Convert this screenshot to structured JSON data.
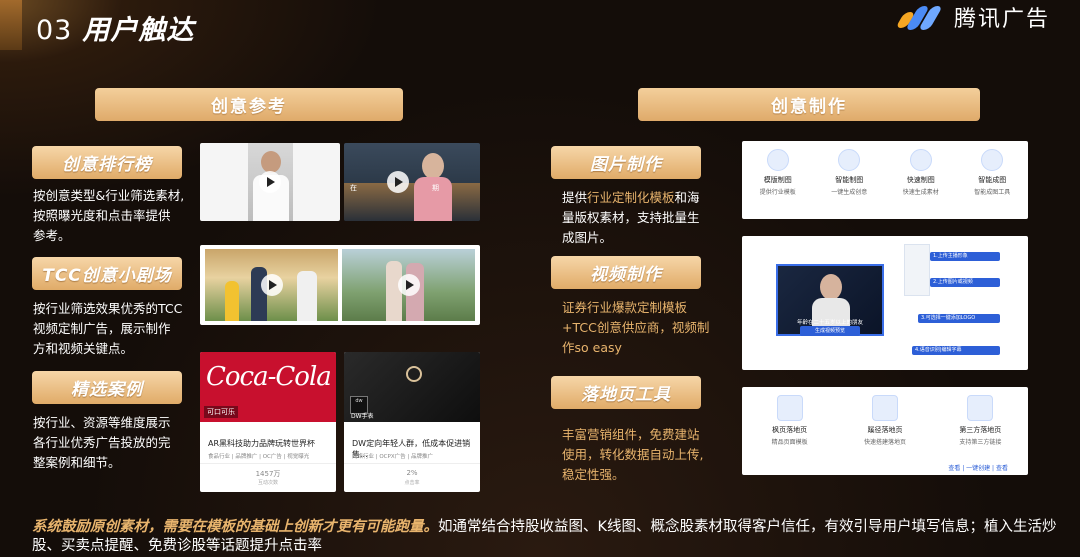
{
  "page": {
    "number": "03",
    "title": "用户触达",
    "brand": "腾讯广告"
  },
  "left": {
    "header": "创意参考",
    "items": [
      {
        "label": "创意排行榜",
        "desc_lines": [
          "按创意类型&行业筛选素材,",
          "按照曝光度和点击率提供",
          "参考。"
        ]
      },
      {
        "label": "TCC创意小剧场",
        "desc_lines": [
          "按行业筛选效果优秀的TCC",
          "视频定制广告，展示制作",
          "方和视频关键点。"
        ]
      },
      {
        "label": "精选案例",
        "desc_lines": [
          "按行业、资源等维度展示",
          "各行业优秀广告投放的完",
          "整案例和细节。"
        ]
      }
    ],
    "cases": [
      {
        "title": "AR黑科技助力品牌玩转世界杯",
        "tags": "食品行业 | 品牌推广 | OC广告 | 视觉曝光",
        "stat": "1457万",
        "stat_label": "互动次数",
        "overlay": "可口可乐",
        "logo": "Coca-Cola"
      },
      {
        "title": "DW定向年轻人群，低成本促进销售...",
        "tags": "网络行业 | OCPX广告 | 品牌推广",
        "stat": "2%",
        "stat_label": "点击率",
        "overlay": "DW手表",
        "logo": "dw"
      }
    ],
    "video_caption": "在",
    "video_caption2": "期"
  },
  "right": {
    "header": "创意制作",
    "items": [
      {
        "label": "图片制作",
        "desc": [
          {
            "t": "提供",
            "hl": false
          },
          {
            "t": "行业定制化模板",
            "hl": true
          },
          {
            "t": "和海",
            "hl": false
          }
        ],
        "desc_lines2": [
          "量版权素材，支持批量生",
          "成图片。"
        ]
      },
      {
        "label": "视频制作",
        "desc_lines": [
          "证券行业爆款定制模板",
          "+TCC创意供应商，视频制",
          "作so easy"
        ]
      },
      {
        "label": "落地页工具",
        "desc_lines": [
          "丰富营销组件，免费建站",
          "使用，转化数据自动上传,",
          "稳定性强。"
        ]
      }
    ],
    "image_tools": [
      {
        "name": "模版制图",
        "desc": "提供行业模板"
      },
      {
        "name": "智能制图",
        "desc": "一键生成创意"
      },
      {
        "name": "快速制图",
        "desc": "快速生成素材"
      },
      {
        "name": "智能成图",
        "desc": "智能成图工具"
      }
    ],
    "video_steps": [
      "1.上传主播形象",
      "2.上传图片或视频",
      "3.可选择一键添加LOGO",
      "4.语音识别|编辑字幕"
    ],
    "video_subtitle": "年龄在二十五岁以上的朋友",
    "video_btn": "生成视频预览",
    "landing_tools": [
      {
        "name": "枫页落地页",
        "desc": "精品页面模板"
      },
      {
        "name": "蹊径落地页",
        "desc": "快速搭建落地页"
      },
      {
        "name": "第三方落地页",
        "desc": "支持第三方链接"
      }
    ],
    "landing_links": "查看 | 一键创建 | 查看"
  },
  "footer": {
    "highlight": "系统鼓励原创素材，需要在模板的基础上创新才更有可能跑量。",
    "text": "如通常结合持股收益图、K线图、概念股素材取得客户信任，有效引导用户填写信息；植入生活炒股、买卖点提醒、免费诊股等话题提升点击率"
  }
}
